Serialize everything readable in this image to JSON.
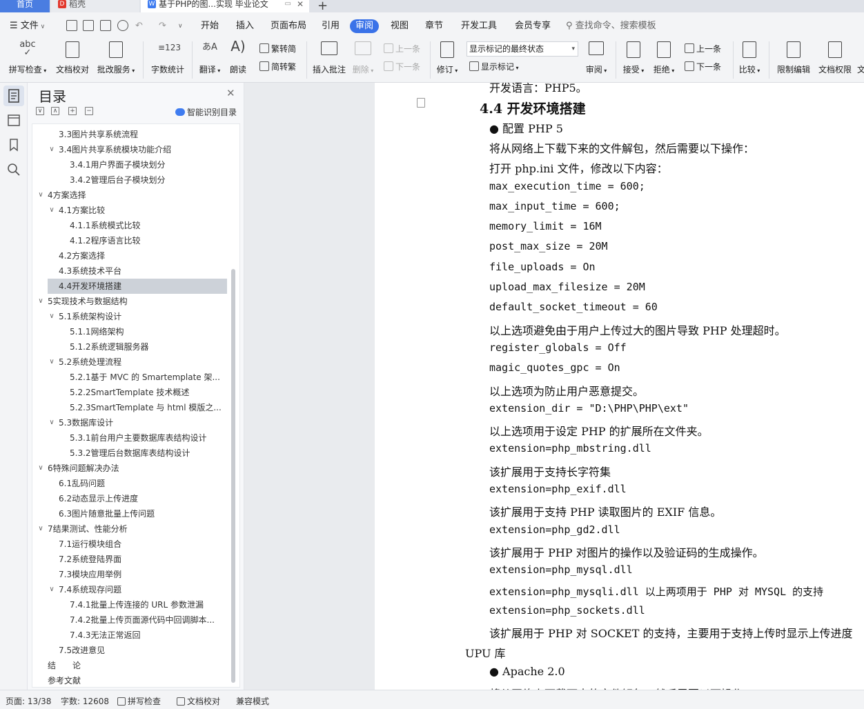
{
  "tabs": {
    "home": "首页",
    "daoke": "稻壳",
    "document": "基于PHP的图...实现 毕业论文"
  },
  "menu": {
    "file": "文件",
    "items": [
      "开始",
      "插入",
      "页面布局",
      "引用",
      "审阅",
      "视图",
      "章节",
      "开发工具",
      "会员专享"
    ],
    "active": "审阅",
    "search": "查找命令、搜索模板"
  },
  "ribbon": {
    "spellcheck": "拼写检查",
    "doc_proofread": "文档校对",
    "batch_service": "批改服务",
    "word_count": "字数统计",
    "translate": "翻译",
    "read_aloud": "朗读",
    "to_simplified": "繁转简",
    "to_traditional": "简转繁",
    "insert_comment": "插入批注",
    "delete": "删除",
    "prev_comment": "上一条",
    "next_comment": "下一条",
    "track_changes": "修订",
    "markup_state": "显示标记的最终状态",
    "show_markup": "显示标记",
    "review": "审阅",
    "accept": "接受",
    "reject": "拒绝",
    "prev_change": "上一条",
    "next_change": "下一条",
    "compare": "比较",
    "restrict_edit": "限制编辑",
    "doc_permission": "文档权限",
    "doc_cut": "文"
  },
  "toc": {
    "title": "目录",
    "smart_label": "智能识别目录",
    "items": [
      {
        "text": "3.3图片共享系统流程",
        "level": 2,
        "chev": ""
      },
      {
        "text": "3.4图片共享系统模块功能介绍",
        "level": 2,
        "chev": "v"
      },
      {
        "text": "3.4.1用户界面子模块划分",
        "level": 3,
        "chev": ""
      },
      {
        "text": "3.4.2管理后台子模块划分",
        "level": 3,
        "chev": ""
      },
      {
        "text": "4方案选择",
        "level": 1,
        "chev": "v"
      },
      {
        "text": "4.1方案比较",
        "level": 2,
        "chev": "v"
      },
      {
        "text": "4.1.1系统模式比较",
        "level": 3,
        "chev": ""
      },
      {
        "text": "4.1.2程序语言比较",
        "level": 3,
        "chev": ""
      },
      {
        "text": "4.2方案选择",
        "level": 2,
        "chev": ""
      },
      {
        "text": "4.3系统技术平台",
        "level": 2,
        "chev": ""
      },
      {
        "text": "4.4开发环境搭建",
        "level": 2,
        "chev": "",
        "selected": true
      },
      {
        "text": "5实现技术与数据结构",
        "level": 1,
        "chev": "v"
      },
      {
        "text": "5.1系统架构设计",
        "level": 2,
        "chev": "v"
      },
      {
        "text": "5.1.1网络架构",
        "level": 3,
        "chev": ""
      },
      {
        "text": "5.1.2系统逻辑服务器",
        "level": 3,
        "chev": ""
      },
      {
        "text": "5.2系统处理流程",
        "level": 2,
        "chev": "v"
      },
      {
        "text": "5.2.1基于 MVC 的 Smartemplate 架...",
        "level": 3,
        "chev": ""
      },
      {
        "text": "5.2.2SmartTemplate 技术概述",
        "level": 3,
        "chev": ""
      },
      {
        "text": "5.2.3SmartTemplate 与 html 模版之...",
        "level": 3,
        "chev": ""
      },
      {
        "text": "5.3数据库设计",
        "level": 2,
        "chev": "v"
      },
      {
        "text": "5.3.1前台用户主要数据库表结构设计",
        "level": 3,
        "chev": ""
      },
      {
        "text": "5.3.2管理后台数据库表结构设计",
        "level": 3,
        "chev": ""
      },
      {
        "text": "6特殊问题解决办法",
        "level": 1,
        "chev": "v"
      },
      {
        "text": "6.1乱码问题",
        "level": 2,
        "chev": ""
      },
      {
        "text": "6.2动态显示上传进度",
        "level": 2,
        "chev": ""
      },
      {
        "text": "6.3图片随意批量上传问题",
        "level": 2,
        "chev": ""
      },
      {
        "text": "7结果测试、性能分析",
        "level": 1,
        "chev": "v"
      },
      {
        "text": "7.1运行模块组合",
        "level": 2,
        "chev": ""
      },
      {
        "text": "7.2系统登陆界面",
        "level": 2,
        "chev": ""
      },
      {
        "text": "7.3模块应用举例",
        "level": 2,
        "chev": ""
      },
      {
        "text": "7.4系统现存问题",
        "level": 2,
        "chev": "v"
      },
      {
        "text": "7.4.1批量上传连接的 URL 参数泄漏",
        "level": 3,
        "chev": ""
      },
      {
        "text": "7.4.2批量上传页面源代码中回调脚本...",
        "level": 3,
        "chev": ""
      },
      {
        "text": "7.4.3无法正常返回",
        "level": 3,
        "chev": ""
      },
      {
        "text": "7.5改进意见",
        "level": 2,
        "chev": ""
      },
      {
        "text": "结　　论",
        "level": 1,
        "chev": ""
      },
      {
        "text": "参考文献",
        "level": 1,
        "chev": ""
      }
    ]
  },
  "document": {
    "lines": [
      {
        "text": "开发语言：PHP5。",
        "kind": "text"
      },
      {
        "text": "4.4  开发环境搭建",
        "kind": "heading"
      },
      {
        "text": "●  配置 PHP 5",
        "kind": "bullet"
      },
      {
        "text": "将从网络上下载下来的文件解包，然后需要以下操作：",
        "kind": "text"
      },
      {
        "text": "打开 php.ini 文件，修改以下内容：",
        "kind": "text"
      },
      {
        "text": "max_execution_time = 600;",
        "kind": "code"
      },
      {
        "text": "max_input_time = 600;",
        "kind": "code"
      },
      {
        "text": "memory_limit = 16M",
        "kind": "code"
      },
      {
        "text": "post_max_size = 20M",
        "kind": "code"
      },
      {
        "text": "file_uploads = On",
        "kind": "code"
      },
      {
        "text": "upload_max_filesize = 20M",
        "kind": "code"
      },
      {
        "text": "default_socket_timeout = 60",
        "kind": "code"
      },
      {
        "text": "以上选项避免由于用户上传过大的图片导致 PHP 处理超时。",
        "kind": "text"
      },
      {
        "text": "register_globals = Off",
        "kind": "code"
      },
      {
        "text": "magic_quotes_gpc = On",
        "kind": "code"
      },
      {
        "text": "以上选项为防止用户恶意提交。",
        "kind": "text"
      },
      {
        "text": "extension_dir = \"D:\\PHP\\PHP\\ext\"",
        "kind": "code"
      },
      {
        "text": "以上选项用于设定 PHP 的扩展所在文件夹。",
        "kind": "text"
      },
      {
        "text": "extension=php_mbstring.dll",
        "kind": "code"
      },
      {
        "text": "该扩展用于支持长字符集",
        "kind": "text"
      },
      {
        "text": "extension=php_exif.dll",
        "kind": "code"
      },
      {
        "text": "该扩展用于支持 PHP 读取图片的 EXIF 信息。",
        "kind": "text"
      },
      {
        "text": "extension=php_gd2.dll",
        "kind": "code"
      },
      {
        "text": "该扩展用于 PHP 对图片的操作以及验证码的生成操作。",
        "kind": "text"
      },
      {
        "text": "extension=php_mysql.dll",
        "kind": "code"
      },
      {
        "text": "extension=php_mysqli.dll 以上两项用于 PHP 对 MYSQL 的支持",
        "kind": "code"
      },
      {
        "text": "extension=php_sockets.dll",
        "kind": "code"
      },
      {
        "text": "该扩展用于 PHP 对 SOCKET 的支持，主要用于支持上传时显示上传进度",
        "kind": "text"
      },
      {
        "text": "UPU 库",
        "kind": "text-left"
      },
      {
        "text": "●  Apache 2.0",
        "kind": "bullet"
      },
      {
        "text": "将从网络上下载下来的文件解包，然后需要以下操作：",
        "kind": "text"
      }
    ]
  },
  "status": {
    "page": "页面: 13/38",
    "words": "字数: 12608",
    "spellcheck": "拼写检查",
    "proofread": "文档校对",
    "compat": "兼容模式"
  },
  "colors": {
    "accent": "#3a72e8",
    "selected_toc": "#cdd2d9"
  }
}
